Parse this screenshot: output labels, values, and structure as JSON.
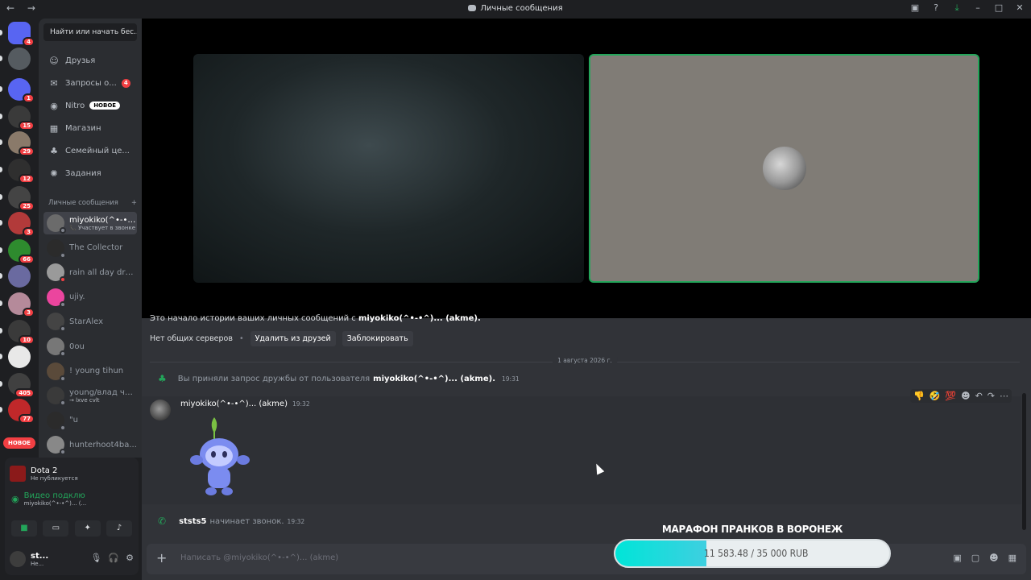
{
  "window": {
    "title": "Личные сообщения",
    "nav": "← →"
  },
  "titlebar_icons": [
    "inbox-icon",
    "help-icon",
    "download-icon",
    "minimize-icon",
    "maximize-icon",
    "close-icon"
  ],
  "guilds": [
    {
      "name": "home",
      "badge": "4",
      "color": "#5865f2"
    },
    {
      "name": "server-2",
      "badge": "",
      "color": "#555b60"
    },
    {
      "name": "server-3",
      "badge": "1",
      "color": "#5865f2"
    },
    {
      "name": "server-4",
      "badge": "15",
      "color": "#3a3a3a"
    },
    {
      "name": "server-5",
      "badge": "29",
      "color": "#8a7a6a"
    },
    {
      "name": "server-6",
      "badge": "12",
      "color": "#2f2f2f"
    },
    {
      "name": "server-7",
      "badge": "25",
      "color": "#444"
    },
    {
      "name": "server-8",
      "badge": "3",
      "color": "#b23a3a"
    },
    {
      "name": "server-9",
      "badge": "66",
      "color": "#2e8b2e"
    },
    {
      "name": "server-10",
      "badge": "",
      "color": "#6a6aa0"
    },
    {
      "name": "server-11",
      "badge": "3",
      "color": "#b58a9a"
    },
    {
      "name": "server-12",
      "badge": "10",
      "color": "#3a3a3a"
    },
    {
      "name": "server-13",
      "badge": "",
      "color": "#e8e8e8"
    },
    {
      "name": "server-14",
      "badge": "405",
      "color": "#404040"
    },
    {
      "name": "server-15",
      "badge": "77",
      "color": "#c0282a"
    }
  ],
  "new_pill": "НОВОЕ",
  "search": {
    "label": "Найти или начать бес..."
  },
  "nav": [
    {
      "icon": "friends-icon",
      "glyph": "☺",
      "label": "Друзья",
      "badge": "",
      "tag": ""
    },
    {
      "icon": "mail-icon",
      "glyph": "✉",
      "label": "Запросы о...",
      "badge": "4",
      "tag": ""
    },
    {
      "icon": "nitro-icon",
      "glyph": "◉",
      "label": "Nitro",
      "badge": "",
      "tag": "НОВОЕ"
    },
    {
      "icon": "shop-icon",
      "glyph": "▦",
      "label": "Магазин",
      "badge": "",
      "tag": ""
    },
    {
      "icon": "family-icon",
      "glyph": "♣",
      "label": "Семейный це...",
      "badge": "",
      "tag": ""
    },
    {
      "icon": "quests-icon",
      "glyph": "✺",
      "label": "Задания",
      "badge": "",
      "tag": ""
    }
  ],
  "dm_header": {
    "label": "Личные сообщения",
    "add": "+"
  },
  "dms": [
    {
      "name": "miyokiko(^•-•^)...",
      "sub": "📞 Участвует в звонке",
      "active": true,
      "status": "",
      "color": "#6b6b6b"
    },
    {
      "name": "The Collector",
      "sub": "",
      "active": false,
      "status": "",
      "color": "#2b2b2b"
    },
    {
      "name": "rain all day dru...",
      "sub": "",
      "active": false,
      "status": "dnd",
      "color": "#9a9a9a"
    },
    {
      "name": "ujiy.",
      "sub": "",
      "active": false,
      "status": "",
      "color": "#eb459e"
    },
    {
      "name": "StarAlex",
      "sub": "",
      "active": false,
      "status": "",
      "color": "#444"
    },
    {
      "name": "0ou",
      "sub": "",
      "active": false,
      "status": "",
      "color": "#777"
    },
    {
      "name": "! young tihun",
      "sub": "",
      "active": false,
      "status": "",
      "color": "#5a4a3a"
    },
    {
      "name": "young/влад че...",
      "sub": "→ lxve cvlt",
      "active": false,
      "status": "",
      "color": "#3a3a3a"
    },
    {
      "name": "\"u",
      "sub": "",
      "active": false,
      "status": "",
      "color": "#2b2b2b"
    },
    {
      "name": "hunterhoot4ba...",
      "sub": "",
      "active": false,
      "status": "",
      "color": "#888"
    }
  ],
  "activity": {
    "name": "Dota 2",
    "sub": "Не публикуется"
  },
  "voice": {
    "title": "Видео подклю",
    "sub": "miyokiko(^•-•^)... (..."
  },
  "user": {
    "name": "st...",
    "sub": "Не..."
  },
  "intro": {
    "line_prefix": "Это начало истории ваших личных сообщений с",
    "line_name": "miyokiko(^•-•^)... (akme).",
    "no_servers": "Нет общих серверов",
    "remove_friend": "Удалить из друзей",
    "block": "Заблокировать"
  },
  "date_divider": "1 августа 2026 г.",
  "friend_accept": {
    "prefix": "Вы приняли запрос дружбы от пользователя",
    "name": "miyokiko(^•-•^)... (akme).",
    "time": "19:31"
  },
  "message": {
    "author": "miyokiko(^•-•^)... (akme)",
    "time": "19:32"
  },
  "call_msg": {
    "name": "ststs5",
    "text": "начинает звонок.",
    "time": "19:32"
  },
  "input": {
    "placeholder": "Написать @miyokiko(^•-•^)... (akme)"
  },
  "overlay": {
    "title": "МАРАФОН ПРАНКОВ В ВОРОНЕЖ",
    "progress_text": "11 583.48 / 35 000 RUB",
    "progress_fraction": 0.331
  }
}
